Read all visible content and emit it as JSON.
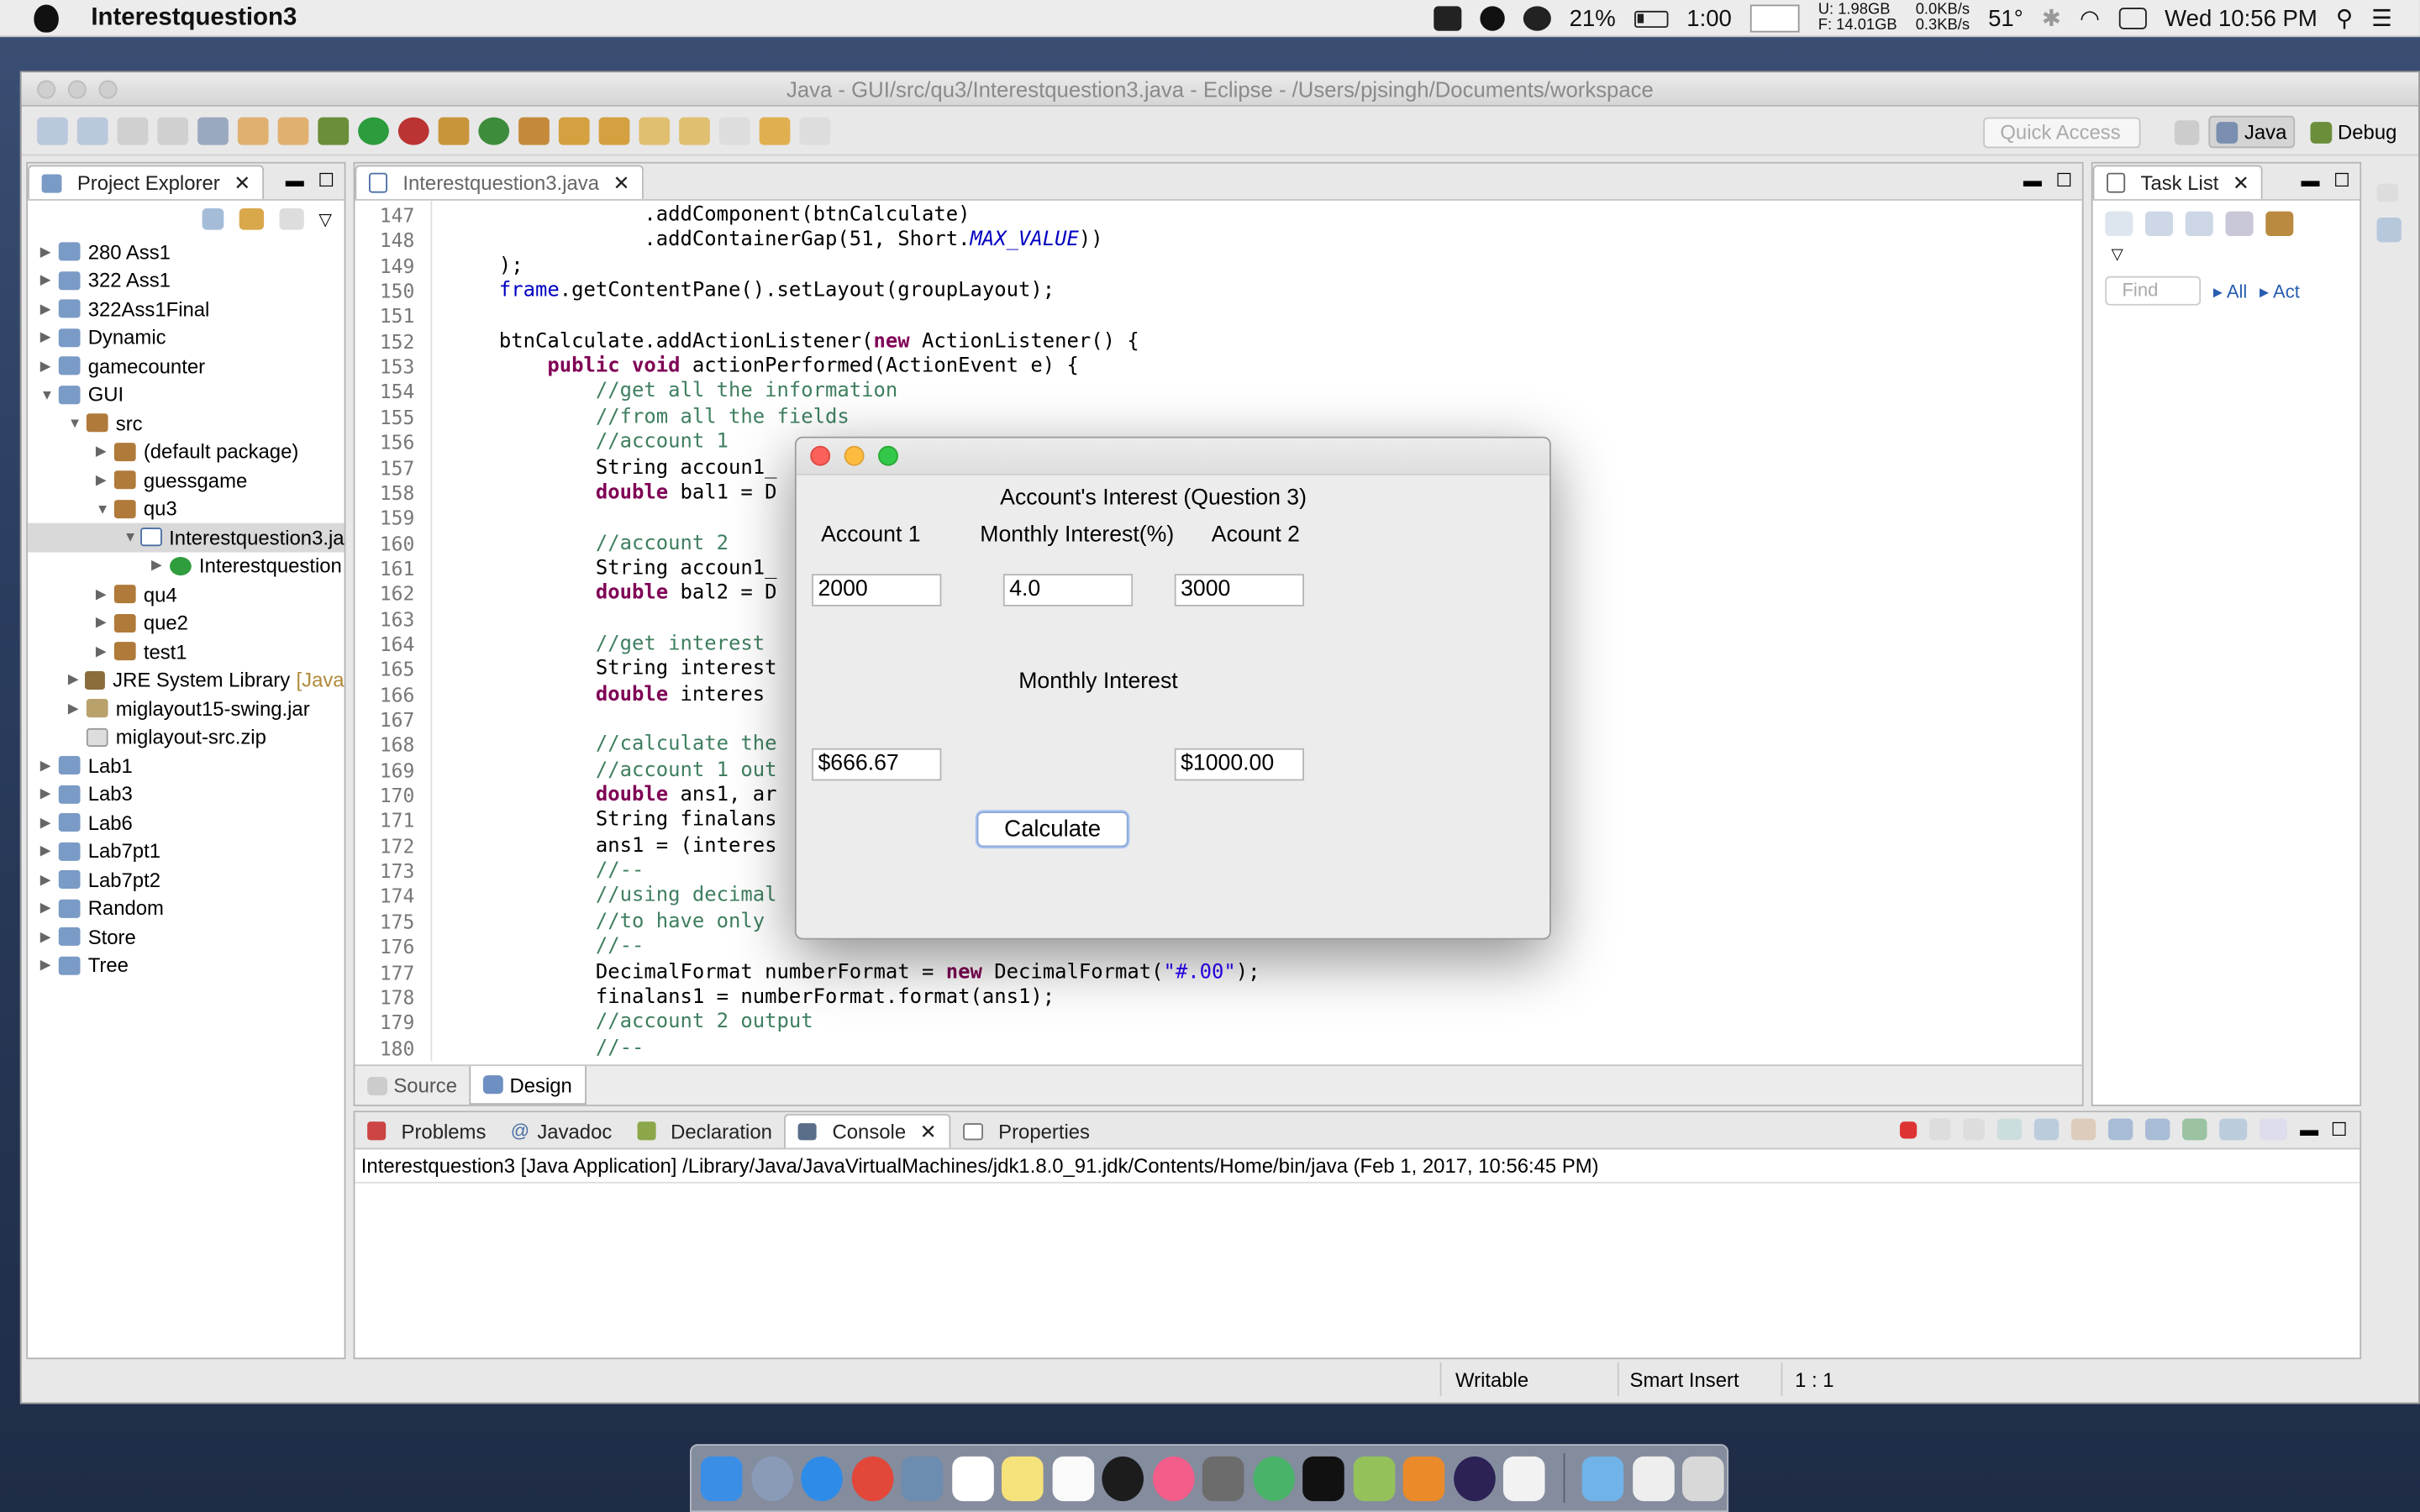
{
  "menubar": {
    "app_name": "Interestquestion3",
    "battery_percent": "21%",
    "time_left": "1:00",
    "mem_used": "U:  1.98GB",
    "mem_free": "F: 14.01GB",
    "net_up": "0.0KB/s",
    "net_down": "0.3KB/s",
    "temperature": "51°",
    "clock": "Wed 10:56 PM"
  },
  "window": {
    "title": "Java - GUI/src/qu3/Interestquestion3.java - Eclipse - /Users/pjsingh/Documents/workspace",
    "quick_access_placeholder": "Quick Access",
    "perspectives": [
      "Java",
      "Debug"
    ]
  },
  "project_explorer": {
    "tab_label": "Project Explorer",
    "items": [
      {
        "label": "280 Ass1",
        "arrow": "▶",
        "indent": 0,
        "icon": "proj"
      },
      {
        "label": "322 Ass1",
        "arrow": "▶",
        "indent": 0,
        "icon": "proj"
      },
      {
        "label": "322Ass1Final",
        "arrow": "▶",
        "indent": 0,
        "icon": "proj"
      },
      {
        "label": "Dynamic",
        "arrow": "▶",
        "indent": 0,
        "icon": "proj"
      },
      {
        "label": "gamecounter",
        "arrow": "▶",
        "indent": 0,
        "icon": "proj"
      },
      {
        "label": "GUI",
        "arrow": "▼",
        "indent": 0,
        "icon": "proj"
      },
      {
        "label": "src",
        "arrow": "▼",
        "indent": 1,
        "icon": "pkg"
      },
      {
        "label": "(default package)",
        "arrow": "▶",
        "indent": 2,
        "icon": "pkg"
      },
      {
        "label": "guessgame",
        "arrow": "▶",
        "indent": 2,
        "icon": "pkg"
      },
      {
        "label": "qu3",
        "arrow": "▼",
        "indent": 2,
        "icon": "pkg"
      },
      {
        "label": "Interestquestion3.ja",
        "arrow": "▼",
        "indent": 3,
        "icon": "java",
        "selected": true
      },
      {
        "label": "Interestquestion",
        "arrow": "▶",
        "indent": 4,
        "icon": "class"
      },
      {
        "label": "qu4",
        "arrow": "▶",
        "indent": 2,
        "icon": "pkg"
      },
      {
        "label": "que2",
        "arrow": "▶",
        "indent": 2,
        "icon": "pkg"
      },
      {
        "label": "test1",
        "arrow": "▶",
        "indent": 2,
        "icon": "pkg"
      },
      {
        "label": "JRE System Library",
        "suffix": "[Java",
        "arrow": "▶",
        "indent": 1,
        "icon": "lib"
      },
      {
        "label": "miglayout15-swing.jar",
        "arrow": "▶",
        "indent": 1,
        "icon": "jar"
      },
      {
        "label": "miglayout-src.zip",
        "arrow": "",
        "indent": 1,
        "icon": "zip"
      },
      {
        "label": "Lab1",
        "arrow": "▶",
        "indent": 0,
        "icon": "proj"
      },
      {
        "label": "Lab3",
        "arrow": "▶",
        "indent": 0,
        "icon": "proj"
      },
      {
        "label": "Lab6",
        "arrow": "▶",
        "indent": 0,
        "icon": "proj"
      },
      {
        "label": "Lab7pt1",
        "arrow": "▶",
        "indent": 0,
        "icon": "proj"
      },
      {
        "label": "Lab7pt2",
        "arrow": "▶",
        "indent": 0,
        "icon": "proj"
      },
      {
        "label": "Random",
        "arrow": "▶",
        "indent": 0,
        "icon": "proj"
      },
      {
        "label": "Store",
        "arrow": "▶",
        "indent": 0,
        "icon": "proj"
      },
      {
        "label": "Tree",
        "arrow": "▶",
        "indent": 0,
        "icon": "proj"
      }
    ]
  },
  "editor": {
    "tab_label": "Interestquestion3.java",
    "lines": [
      {
        "n": "147",
        "html": "                .addComponent(btnCalculate)"
      },
      {
        "n": "148",
        "html": "                .addContainerGap(51, Short.<span class='it'>MAX_VALUE</span>))"
      },
      {
        "n": "149",
        "html": "    );"
      },
      {
        "n": "150",
        "html": "    <span class='fld'>frame</span>.getContentPane().setLayout(groupLayout);"
      },
      {
        "n": "151",
        "html": ""
      },
      {
        "n": "152",
        "html": "    btnCalculate.addActionListener(<span class='kw'>new</span> ActionListener() {"
      },
      {
        "n": "153",
        "html": "        <span class='kw'>public void</span> actionPerformed(ActionEvent e) {"
      },
      {
        "n": "154",
        "html": "            <span class='cm'>//get all the information</span>"
      },
      {
        "n": "155",
        "html": "            <span class='cm'>//from all the fields</span>"
      },
      {
        "n": "156",
        "html": "            <span class='cm'>//account 1</span>"
      },
      {
        "n": "157",
        "html": "            String accoun1_"
      },
      {
        "n": "158",
        "html": "            <span class='kw'>double</span> bal1 = D"
      },
      {
        "n": "159",
        "html": ""
      },
      {
        "n": "160",
        "html": "            <span class='cm'>//account 2</span>"
      },
      {
        "n": "161",
        "html": "            String accoun1_"
      },
      {
        "n": "162",
        "html": "            <span class='kw'>double</span> bal2 = D"
      },
      {
        "n": "163",
        "html": ""
      },
      {
        "n": "164",
        "html": "            <span class='cm'>//get interest</span>"
      },
      {
        "n": "165",
        "html": "            String interest"
      },
      {
        "n": "166",
        "html": "            <span class='kw'>double</span> interes"
      },
      {
        "n": "167",
        "html": ""
      },
      {
        "n": "168",
        "html": "            <span class='cm'>//calculate the</span>"
      },
      {
        "n": "169",
        "html": "            <span class='cm'>//account 1 out</span>"
      },
      {
        "n": "170",
        "html": "            <span class='kw'>double</span> ans1, ar"
      },
      {
        "n": "171",
        "html": "            String finalans"
      },
      {
        "n": "172",
        "html": "            ans1 = (interes"
      },
      {
        "n": "173",
        "html": "            <span class='cm'>//--</span>"
      },
      {
        "n": "174",
        "html": "            <span class='cm'>//using decimal</span>"
      },
      {
        "n": "175",
        "html": "            <span class='cm'>//to have only</span>"
      },
      {
        "n": "176",
        "html": "            <span class='cm'>//--</span>"
      },
      {
        "n": "177",
        "html": "            DecimalFormat numberFormat = <span class='kw'>new</span> DecimalFormat(<span class='st'>\"#.00\"</span>);"
      },
      {
        "n": "178",
        "html": "            finalans1 = numberFormat.format(ans1);"
      },
      {
        "n": "179",
        "html": "            <span class='cm'>//account 2 output</span>"
      },
      {
        "n": "180",
        "html": "            <span class='cm'>//--</span>"
      }
    ],
    "bottom_tabs": [
      "Source",
      "Design"
    ]
  },
  "task_list": {
    "tab_label": "Task List",
    "find_placeholder": "Find",
    "all_label": "All",
    "act_label": "Act"
  },
  "bottom_panel": {
    "tabs": [
      "Problems",
      "Javadoc",
      "Declaration",
      "Console",
      "Properties"
    ],
    "console_line": "Interestquestion3 [Java Application] /Library/Java/JavaVirtualMachines/jdk1.8.0_91.jdk/Contents/Home/bin/java (Feb 1, 2017, 10:56:45 PM)"
  },
  "status": {
    "writable": "Writable",
    "insert_mode": "Smart Insert",
    "position": "1 : 1"
  },
  "dialog": {
    "title": "Account's Interest (Question 3)",
    "account1_label": "Account 1",
    "monthly_interest_label": "Monthly Interest(%)",
    "account2_label": "Acount 2",
    "account1_value": "2000",
    "interest_value": "4.0",
    "account2_value": "3000",
    "monthly_interest_heading": "Monthly Interest",
    "result1": "$666.67",
    "result2": "$1000.00",
    "calculate_label": "Calculate"
  }
}
